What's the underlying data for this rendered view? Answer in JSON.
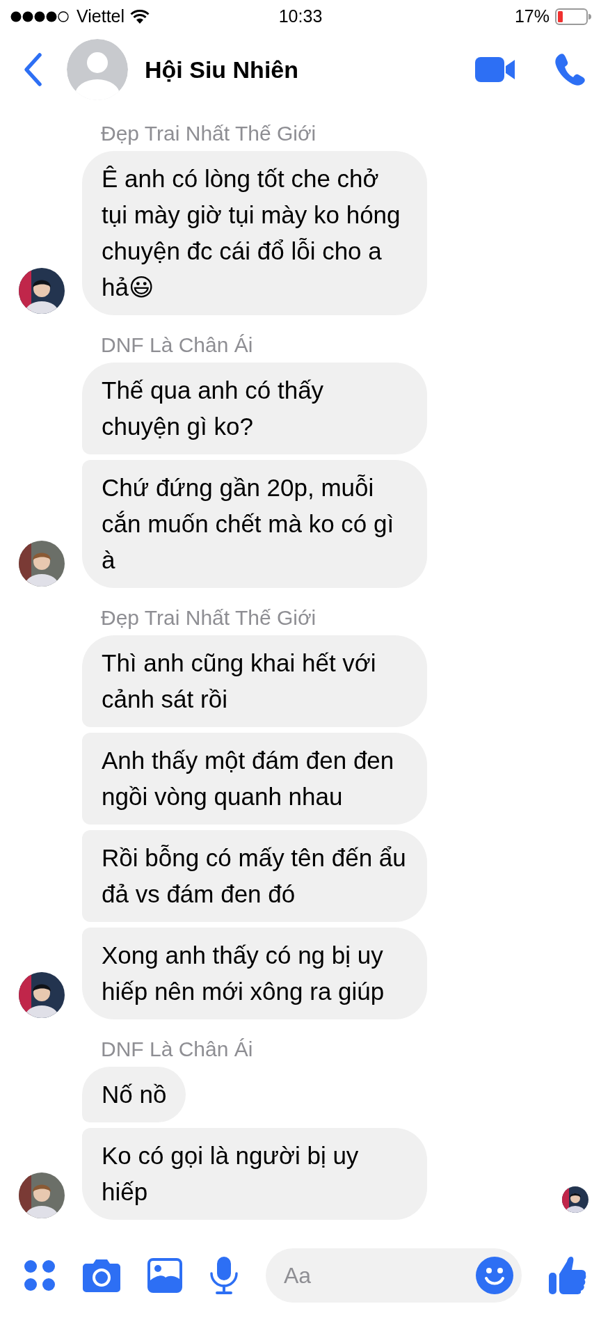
{
  "status_bar": {
    "carrier": "Viettel",
    "time": "10:33",
    "battery": "17%"
  },
  "header": {
    "title": "Hội Siu Nhiên"
  },
  "groups": [
    {
      "sender": "Đẹp Trai Nhất Thế Giới",
      "color": "#23344f",
      "messages": [
        "Ê anh có lòng tốt che chở tụi mày giờ tụi mày ko hóng chuyện đc cái đổ lỗi cho a hả😃"
      ]
    },
    {
      "sender": "DNF Là Chân Ái",
      "color": "#6b6f68",
      "messages": [
        "Thế qua anh có thấy chuyện gì ko?",
        "Chứ đứng gần 20p, muỗi cắn muốn chết mà ko có gì à"
      ]
    },
    {
      "sender": "Đẹp Trai Nhất Thế Giới",
      "color": "#23344f",
      "messages": [
        "Thì anh cũng khai hết với cảnh sát rồi",
        "Anh thấy một đám đen đen ngồi vòng quanh nhau",
        "Rồi bỗng có mấy tên đến ẩu đả vs đám đen đó",
        "Xong anh thấy có ng bị uy hiếp nên mới xông ra giúp"
      ]
    },
    {
      "sender": "DNF Là Chân Ái",
      "color": "#6b6f68",
      "seen": true,
      "messages": [
        "Nố nồ",
        "Ko có gọi là người bị uy hiếp"
      ]
    }
  ],
  "composer": {
    "placeholder": "Aa"
  }
}
